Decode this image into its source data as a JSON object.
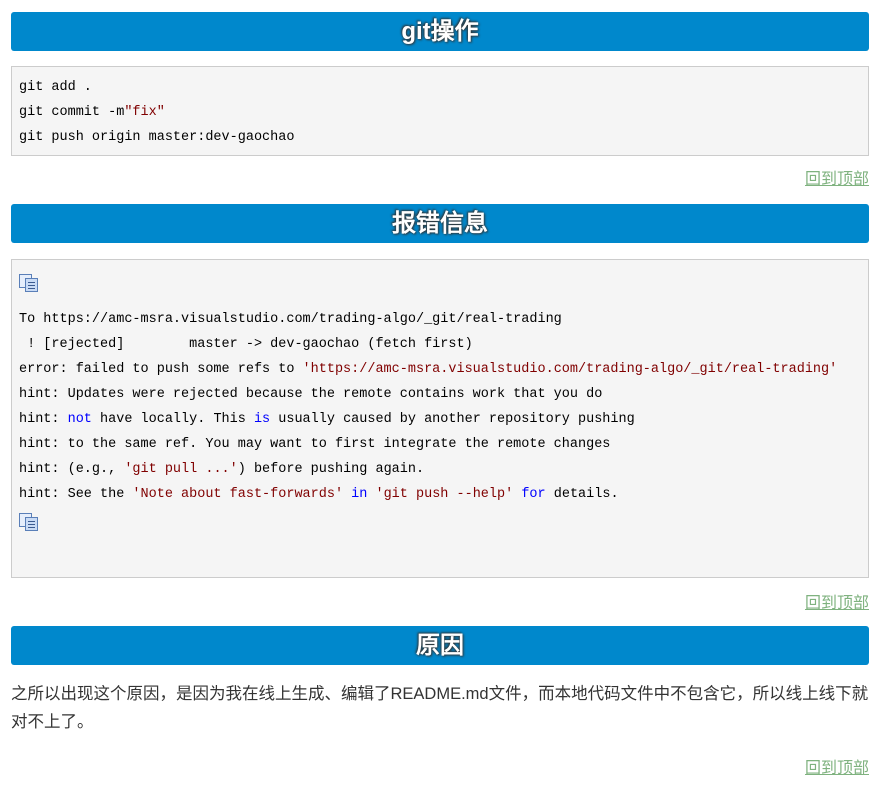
{
  "sections": {
    "git_ops": {
      "title": "git操作",
      "code_lines": [
        "git add .",
        "git commit -m",
        "\"fix\"",
        "git push origin master:dev-gaochao"
      ]
    },
    "error": {
      "title": "报错信息",
      "line1": "To https://amc-msra.visualstudio.com/trading-algo/_git/real-trading",
      "line2": " ! [rejected]        master -> dev-gaochao (fetch first)",
      "line3_a": "error: failed to push some refs to ",
      "line3_b": "'https://amc-msra.visualstudio.com/trading-algo/_git/real-trading'",
      "line4": "hint: Updates were rejected because the remote contains work that you do",
      "line5_a": "hint: ",
      "line5_b": "not",
      "line5_c": " have locally. This ",
      "line5_d": "is",
      "line5_e": " usually caused by another repository pushing",
      "line6": "hint: to the same ref. You may want to first integrate the remote changes",
      "line7_a": "hint: (e.g., ",
      "line7_b": "'git pull ...'",
      "line7_c": ") before pushing again.",
      "line8_a": "hint: See the ",
      "line8_b": "'Note about fast-forwards'",
      "line8_c": " ",
      "line8_d": "in",
      "line8_e": " ",
      "line8_f": "'git push --help'",
      "line8_g": " ",
      "line8_h": "for",
      "line8_i": " details."
    },
    "reason": {
      "title": "原因",
      "text": "之所以出现这个原因，是因为我在线上生成、编辑了README.md文件，而本地代码文件中不包含它，所以线上线下就对不上了。"
    }
  },
  "back_to_top": "回到顶部",
  "icons": {
    "copy": "copy-icon"
  },
  "colors": {
    "heading_bg": "#0088cc",
    "link": "#7fb27f",
    "string": "#800000",
    "keyword": "#0000ff"
  }
}
